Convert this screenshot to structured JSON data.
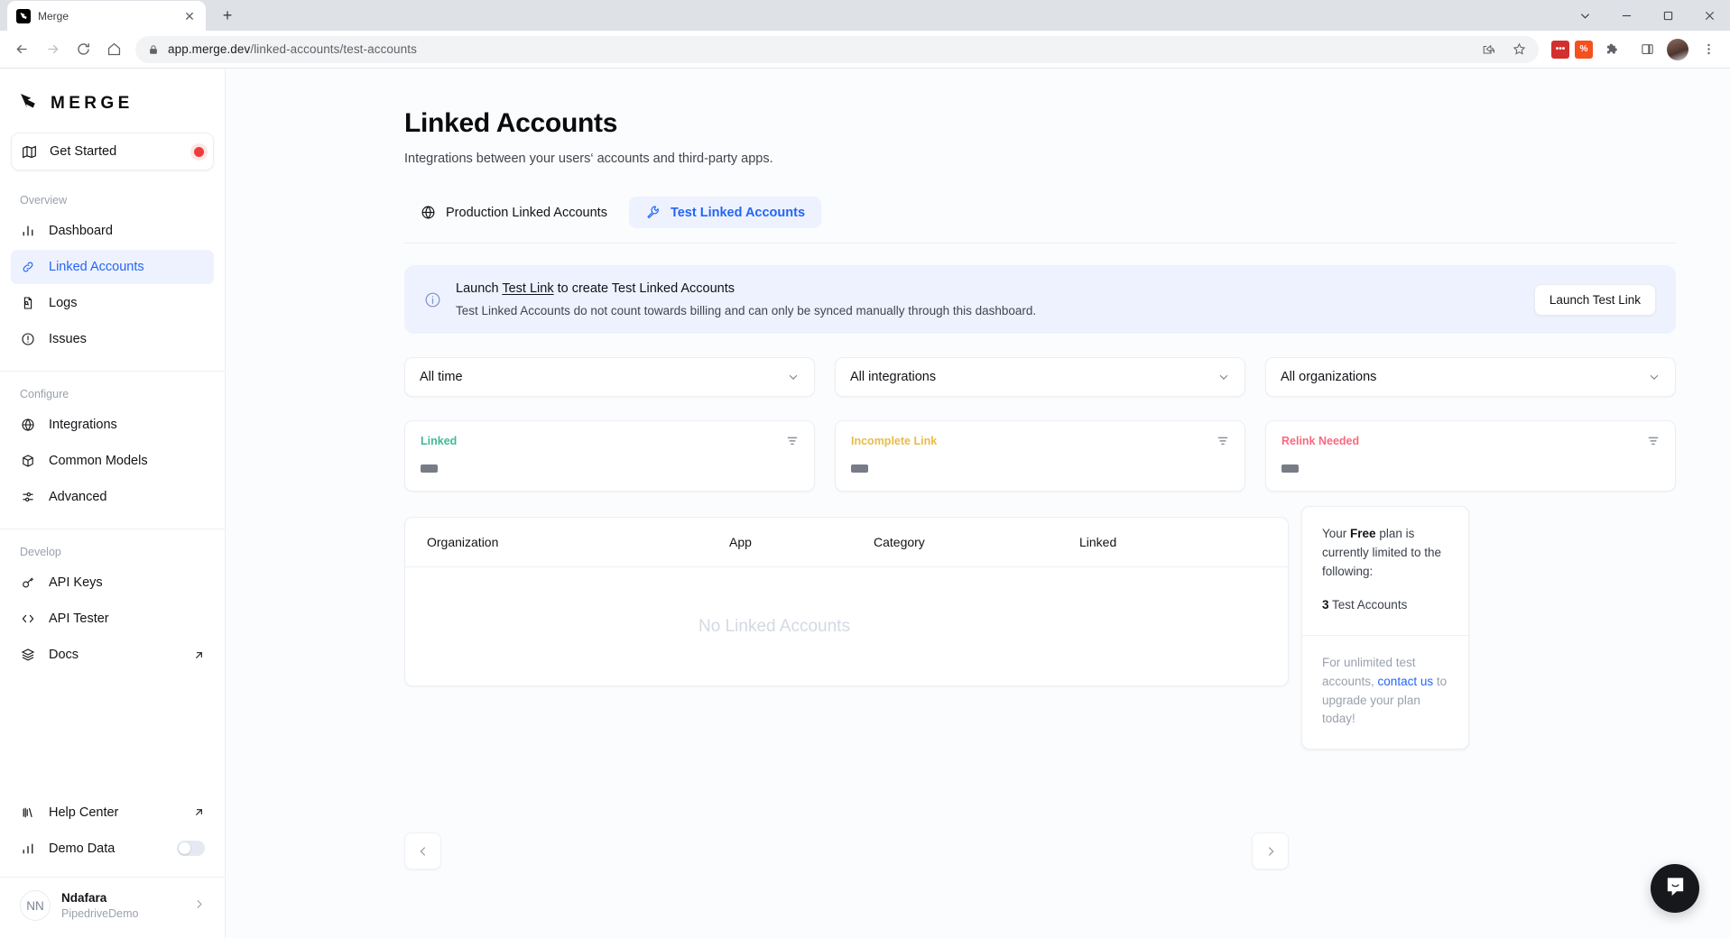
{
  "browser": {
    "tab_title": "Merge",
    "url_host": "app.merge.dev",
    "url_path": "/linked-accounts/test-accounts",
    "new_tab_label": "+",
    "close_tab_label": "✕",
    "minimize_label": "—",
    "maximize_label": "☐",
    "window_close_label": "✕",
    "ext_red_label": "•••",
    "ext_orange_label": "%"
  },
  "sidebar": {
    "logo_text": "MERGE",
    "get_started": {
      "label": "Get Started",
      "has_badge": true
    },
    "sections": [
      {
        "label": "Overview",
        "items": [
          {
            "label": "Dashboard",
            "icon": "bar-chart-icon",
            "active": false
          },
          {
            "label": "Linked Accounts",
            "icon": "link-icon",
            "active": true
          },
          {
            "label": "Logs",
            "icon": "file-search-icon",
            "active": false
          },
          {
            "label": "Issues",
            "icon": "alert-circle-icon",
            "active": false
          }
        ]
      },
      {
        "label": "Configure",
        "items": [
          {
            "label": "Integrations",
            "icon": "globe-icon",
            "active": false
          },
          {
            "label": "Common Models",
            "icon": "box-icon",
            "active": false
          },
          {
            "label": "Advanced",
            "icon": "sliders-icon",
            "active": false
          }
        ]
      },
      {
        "label": "Develop",
        "items": [
          {
            "label": "API Keys",
            "icon": "key-icon",
            "active": false
          },
          {
            "label": "API Tester",
            "icon": "code-icon",
            "active": false
          },
          {
            "label": "Docs",
            "icon": "layers-icon",
            "active": false,
            "external": true
          }
        ]
      }
    ],
    "help_center": "Help Center",
    "demo_data": "Demo Data",
    "demo_data_enabled": false,
    "user": {
      "initials": "NN",
      "name": "Ndafara",
      "org": "PipedriveDemo"
    }
  },
  "main": {
    "title": "Linked Accounts",
    "subtitle": "Integrations between your users‘ accounts and third-party apps.",
    "tabs": [
      {
        "label": "Production Linked Accounts",
        "icon": "globe-icon",
        "active": false
      },
      {
        "label": "Test Linked Accounts",
        "icon": "wrench-icon",
        "active": true
      }
    ],
    "banner": {
      "title_before": "Launch ",
      "title_link": "Test Link",
      "title_after": " to create Test Linked Accounts",
      "subtitle": "Test Linked Accounts do not count towards billing and can only be synced manually through this dashboard.",
      "button": "Launch Test Link"
    },
    "filters": [
      {
        "value": "All time",
        "name": "time-filter"
      },
      {
        "value": "All integrations",
        "name": "integrations-filter"
      },
      {
        "value": "All organizations",
        "name": "organizations-filter"
      }
    ],
    "stats": [
      {
        "label": "Linked",
        "color": "#3fb997",
        "value": ""
      },
      {
        "label": "Incomplete Link",
        "color": "#e8bb49",
        "value": ""
      },
      {
        "label": "Relink Needed",
        "color": "#f9697f",
        "value": ""
      }
    ],
    "table": {
      "columns": [
        "Organization",
        "App",
        "Category",
        "Linked"
      ],
      "empty_text": "No Linked Accounts",
      "rows": []
    },
    "plan": {
      "line1_a": "Your ",
      "line1_b": "Free",
      "line1_c": " plan is currently limited to the following:",
      "count": "3",
      "count_label": " Test Accounts",
      "footer_a": "For unlimited test accounts, ",
      "footer_link": "contact us",
      "footer_b": " to upgrade your plan today!"
    },
    "pagination": {
      "prev": "‹",
      "next": "›"
    }
  },
  "colors": {
    "accent": "#2266f5",
    "accent_bg": "#eef2ff",
    "page_bg": "#fbfcfe"
  }
}
